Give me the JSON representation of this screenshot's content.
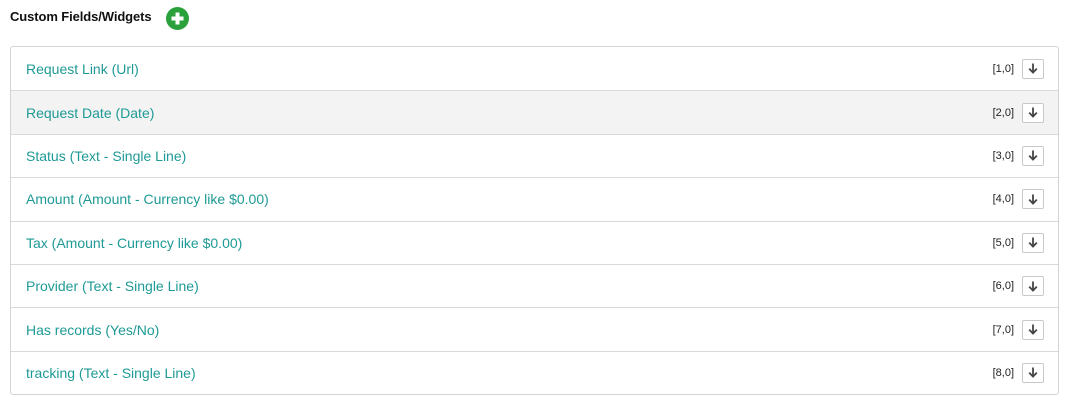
{
  "header": {
    "title": "Custom Fields/Widgets",
    "add_icon": "plus-circle-icon",
    "add_color": "#2aa13a"
  },
  "fields": [
    {
      "label": "Request Link (Url)",
      "position": "[1,0]",
      "highlighted": false
    },
    {
      "label": "Request Date (Date)",
      "position": "[2,0]",
      "highlighted": true
    },
    {
      "label": "Status (Text - Single Line)",
      "position": "[3,0]",
      "highlighted": false
    },
    {
      "label": "Amount (Amount - Currency like $0.00)",
      "position": "[4,0]",
      "highlighted": false
    },
    {
      "label": "Tax (Amount - Currency like $0.00)",
      "position": "[5,0]",
      "highlighted": false
    },
    {
      "label": "Provider (Text - Single Line)",
      "position": "[6,0]",
      "highlighted": false
    },
    {
      "label": "Has records (Yes/No)",
      "position": "[7,0]",
      "highlighted": false
    },
    {
      "label": "tracking (Text - Single Line)",
      "position": "[8,0]",
      "highlighted": false
    }
  ],
  "row_action_icon": "arrow-down-icon",
  "link_color": "#1e9a96"
}
